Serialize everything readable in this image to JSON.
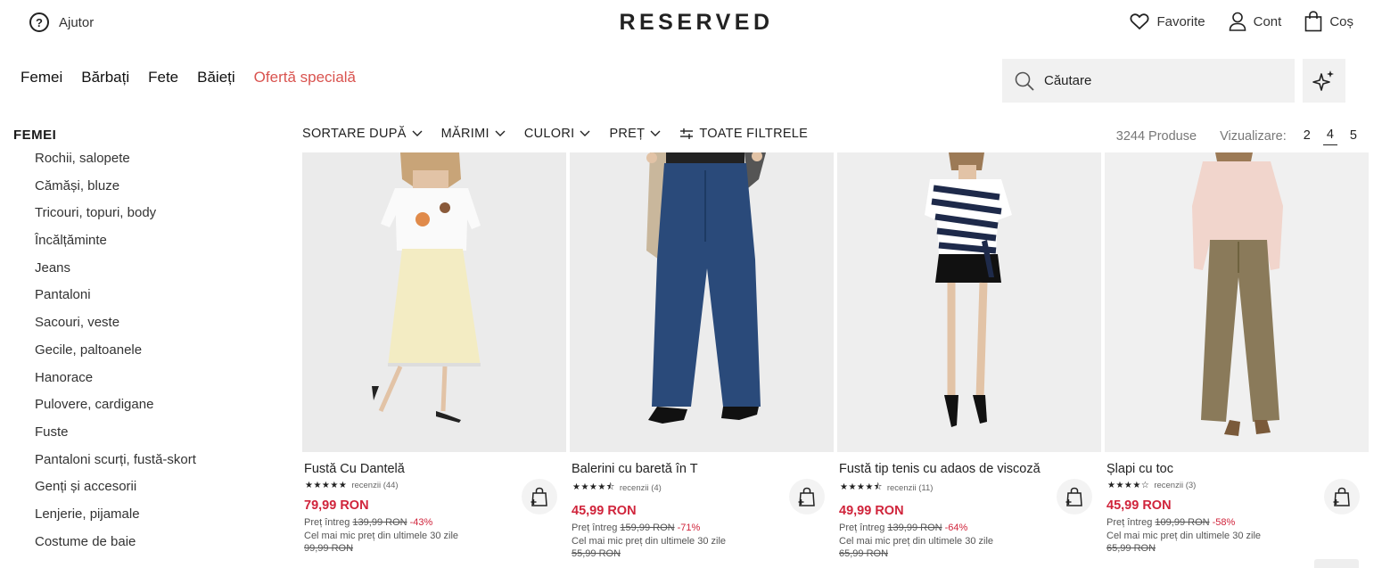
{
  "header": {
    "help_label": "Ajutor",
    "logo": "RESERVED",
    "favorites_label": "Favorite",
    "account_label": "Cont",
    "cart_label": "Coș"
  },
  "nav": {
    "items": [
      "Femei",
      "Bărbați",
      "Fete",
      "Băieți"
    ],
    "promo": "Ofertă specială"
  },
  "search": {
    "placeholder": "Căutare"
  },
  "sidebar": {
    "title": "FEMEI",
    "items": [
      "Rochii, salopete",
      "Cămăși, bluze",
      "Tricouri, topuri, body",
      "Încălțăminte",
      "Jeans",
      "Pantaloni",
      "Sacouri, veste",
      "Gecile, paltoanele",
      "Hanorace",
      "Pulovere, cardigane",
      "Fuste",
      "Pantaloni scurți, fustă-skort",
      "Genți și accesorii",
      "Lenjerie, pijamale",
      "Costume de baie"
    ]
  },
  "filters": {
    "sort": "SORTARE DUPĂ",
    "sizes": "MĂRIMI",
    "colors": "CULORI",
    "price": "PREȚ",
    "all": "TOATE FILTRELE"
  },
  "listing": {
    "count": "3244 Produse",
    "view_label": "Vizualizare:",
    "view_options": [
      "2",
      "4",
      "5"
    ],
    "view_selected": "4"
  },
  "products": [
    {
      "name": "Fustă Cu Dantelă",
      "rating": 5,
      "reviews": "recenzii (44)",
      "price": "79,99 RON",
      "full_label": "Preț întreg",
      "full_price": "139,99 RON",
      "discount": "-43%",
      "lowest_label": "Cel mai mic preț din ultimele 30 zile",
      "lowest_price": "99,99 RON"
    },
    {
      "name": "Balerini cu baretă în T",
      "rating": 4.5,
      "reviews": "recenzii (4)",
      "price": "45,99 RON",
      "full_label": "Preț întreg",
      "full_price": "159,99 RON",
      "discount": "-71%",
      "lowest_label": "Cel mai mic preț din ultimele 30 zile",
      "lowest_price": "55,99 RON"
    },
    {
      "name": "Fustă tip tenis cu adaos de viscoză",
      "rating": 4.5,
      "reviews": "recenzii (11)",
      "price": "49,99 RON",
      "full_label": "Preț întreg",
      "full_price": "139,99 RON",
      "discount": "-64%",
      "lowest_label": "Cel mai mic preț din ultimele 30 zile",
      "lowest_price": "65,99 RON"
    },
    {
      "name": "Șlapi cu toc",
      "rating": 4,
      "reviews": "recenzii (3)",
      "price": "45,99 RON",
      "full_label": "Preț întreg",
      "full_price": "109,99 RON",
      "discount": "-58%",
      "lowest_label": "Cel mai mic preț din ultimele 30 zile",
      "lowest_price": "65,99 RON"
    }
  ],
  "colors": {
    "promo": "#d9534f",
    "sale_price": "#d0243b",
    "search_bg": "#f1f1f1"
  }
}
